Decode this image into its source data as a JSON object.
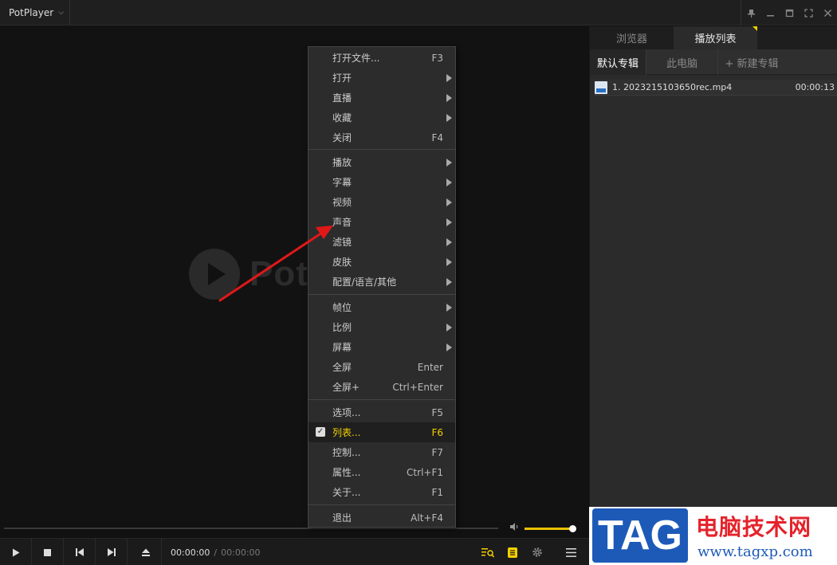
{
  "app": {
    "name": "PotPlayer",
    "logo_text": "PotPlayer"
  },
  "window_controls": [
    "pin-icon",
    "minimize-icon",
    "maximize-icon",
    "fullscreen-icon",
    "close-icon"
  ],
  "panel": {
    "tabs": [
      {
        "label": "浏览器",
        "active": false
      },
      {
        "label": "播放列表",
        "active": true
      }
    ],
    "subtabs": [
      {
        "label": "默认专辑",
        "active": true
      },
      {
        "label": "此电脑",
        "active": false
      },
      {
        "label": "+ 新建专辑",
        "active": false
      }
    ],
    "items": [
      {
        "title": "1. 2023215103650rec.mp4",
        "duration": "00:00:13"
      }
    ]
  },
  "menu": {
    "groups": [
      [
        {
          "label": "打开文件...",
          "shortcut": "F3",
          "submenu": false
        },
        {
          "label": "打开",
          "shortcut": "",
          "submenu": true
        },
        {
          "label": "直播",
          "shortcut": "",
          "submenu": true
        },
        {
          "label": "收藏",
          "shortcut": "",
          "submenu": true
        },
        {
          "label": "关闭",
          "shortcut": "F4",
          "submenu": false
        }
      ],
      [
        {
          "label": "播放",
          "shortcut": "",
          "submenu": true
        },
        {
          "label": "字幕",
          "shortcut": "",
          "submenu": true
        },
        {
          "label": "视频",
          "shortcut": "",
          "submenu": true
        },
        {
          "label": "声音",
          "shortcut": "",
          "submenu": true
        },
        {
          "label": "滤镜",
          "shortcut": "",
          "submenu": true
        },
        {
          "label": "皮肤",
          "shortcut": "",
          "submenu": true
        },
        {
          "label": "配置/语言/其他",
          "shortcut": "",
          "submenu": true
        }
      ],
      [
        {
          "label": "帧位",
          "shortcut": "",
          "submenu": true
        },
        {
          "label": "比例",
          "shortcut": "",
          "submenu": true
        },
        {
          "label": "屏幕",
          "shortcut": "",
          "submenu": true
        },
        {
          "label": "全屏",
          "shortcut": "Enter",
          "submenu": false
        },
        {
          "label": "全屏+",
          "shortcut": "Ctrl+Enter",
          "submenu": false
        }
      ],
      [
        {
          "label": "选项...",
          "shortcut": "F5",
          "submenu": false
        },
        {
          "label": "列表...",
          "shortcut": "F6",
          "submenu": false,
          "checked": true
        },
        {
          "label": "控制...",
          "shortcut": "F7",
          "submenu": false
        },
        {
          "label": "属性...",
          "shortcut": "Ctrl+F1",
          "submenu": false
        },
        {
          "label": "关于...",
          "shortcut": "F1",
          "submenu": false
        }
      ],
      [
        {
          "label": "退出",
          "shortcut": "Alt+F4",
          "submenu": false
        }
      ]
    ]
  },
  "playback": {
    "current_time": "00:00:00",
    "separator": "/",
    "total_time": "00:00:00",
    "volume_level": 1.0,
    "buttons": [
      "play-icon",
      "stop-icon",
      "previous-icon",
      "next-icon",
      "eject-icon"
    ]
  },
  "watermark": {
    "tag": "TAG",
    "title": "电脑技术网",
    "url": "www.tagxp.com"
  },
  "colors": {
    "accent": "#f2d000",
    "background": "#121212",
    "panel": "#2b2b2b",
    "menu": "#2c2c2c",
    "annotation_arrow": "#e01818",
    "watermark_blue": "#1d5ab8",
    "watermark_red": "#e4232b"
  }
}
